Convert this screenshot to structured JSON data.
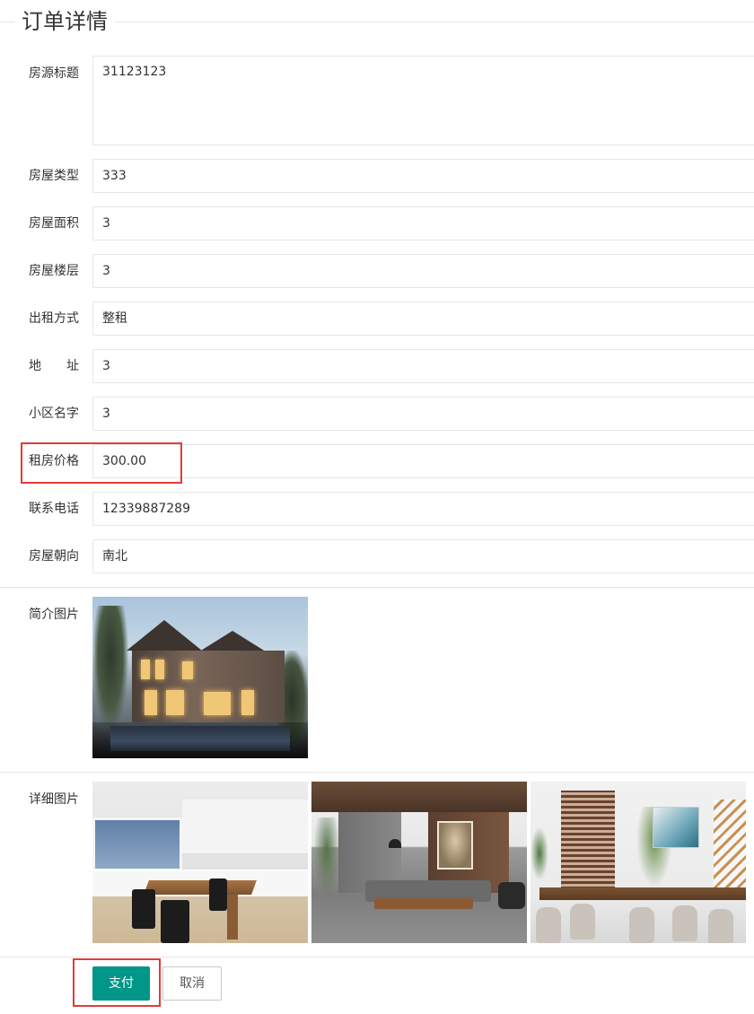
{
  "page": {
    "title": "订单详情"
  },
  "fields": {
    "title": {
      "label": "房源标题",
      "value": "31123123"
    },
    "house_type": {
      "label": "房屋类型",
      "value": "333"
    },
    "area": {
      "label": "房屋面积",
      "value": "3"
    },
    "floor": {
      "label": "房屋楼层",
      "value": "3"
    },
    "rent_mode": {
      "label": "出租方式",
      "value": "整租"
    },
    "address": {
      "label_chars": [
        "地",
        "址"
      ],
      "value": "3"
    },
    "community": {
      "label": "小区名字",
      "value": "3"
    },
    "price": {
      "label": "租房价格",
      "value": "300.00"
    },
    "phone": {
      "label": "联系电话",
      "value": "12339887289"
    },
    "orientation": {
      "label": "房屋朝向",
      "value": "南北"
    }
  },
  "images": {
    "intro_label": "简介图片",
    "detail_label": "详细图片",
    "intro": {
      "icon": "villa-exterior-photo"
    },
    "details": [
      {
        "icon": "kitchen-photo"
      },
      {
        "icon": "living-room-photo"
      },
      {
        "icon": "dining-room-photo"
      }
    ]
  },
  "actions": {
    "pay_label": "支付",
    "cancel_label": "取消"
  },
  "colors": {
    "primary": "#009688",
    "highlight": "#e03c3c",
    "border": "#e6e6e6"
  }
}
